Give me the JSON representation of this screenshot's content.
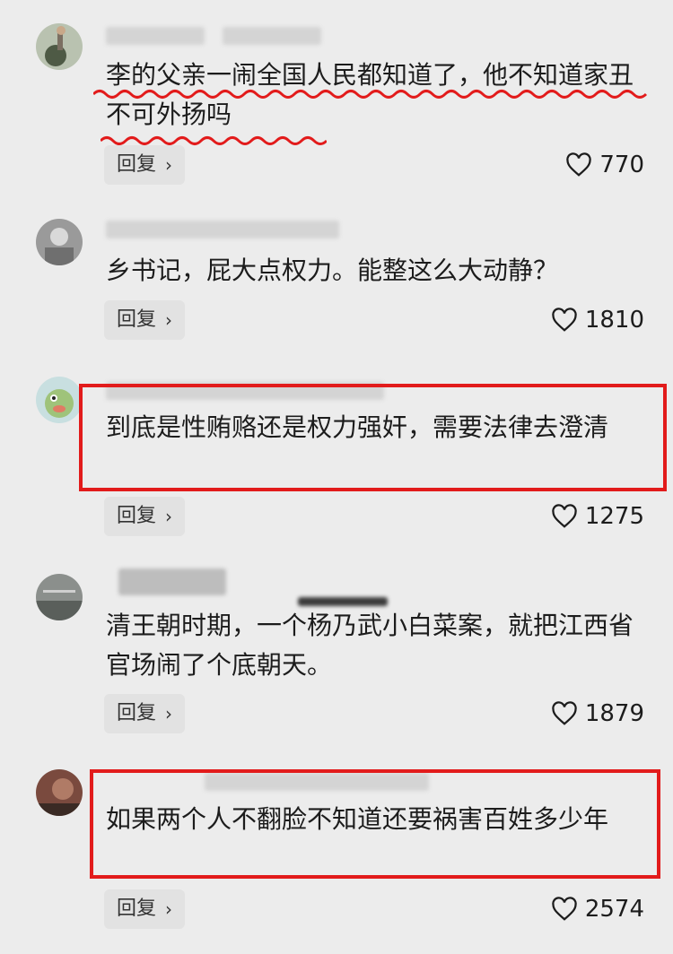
{
  "comments": [
    {
      "text": "李的父亲一闹全国人民都知道了，他不知道家丑不可外扬吗",
      "reply_label": "回复",
      "likes": "770",
      "highlight": "wavy-underline",
      "highlight_color": "#e21b1b"
    },
    {
      "text": "乡书记，屁大点权力。能整这么大动静？",
      "reply_label": "回复",
      "likes": "1810"
    },
    {
      "text": "到底是性贿赂还是权力强奸，需要法律去澄清",
      "reply_label": "回复",
      "likes": "1275",
      "highlight": "red-box",
      "highlight_color": "#e21b1b"
    },
    {
      "text": "清王朝时期，一个杨乃武小白菜案，就把江西省官场闹了个底朝天。",
      "reply_label": "回复",
      "likes": "1879"
    },
    {
      "text": "如果两个人不翻脸不知道还要祸害百姓多少年",
      "reply_label": "回复",
      "likes": "2574",
      "highlight": "red-box",
      "highlight_color": "#e21b1b"
    }
  ],
  "icons": {
    "like": "heart-outline-icon",
    "reply_chevron": "chevron-right-icon"
  }
}
